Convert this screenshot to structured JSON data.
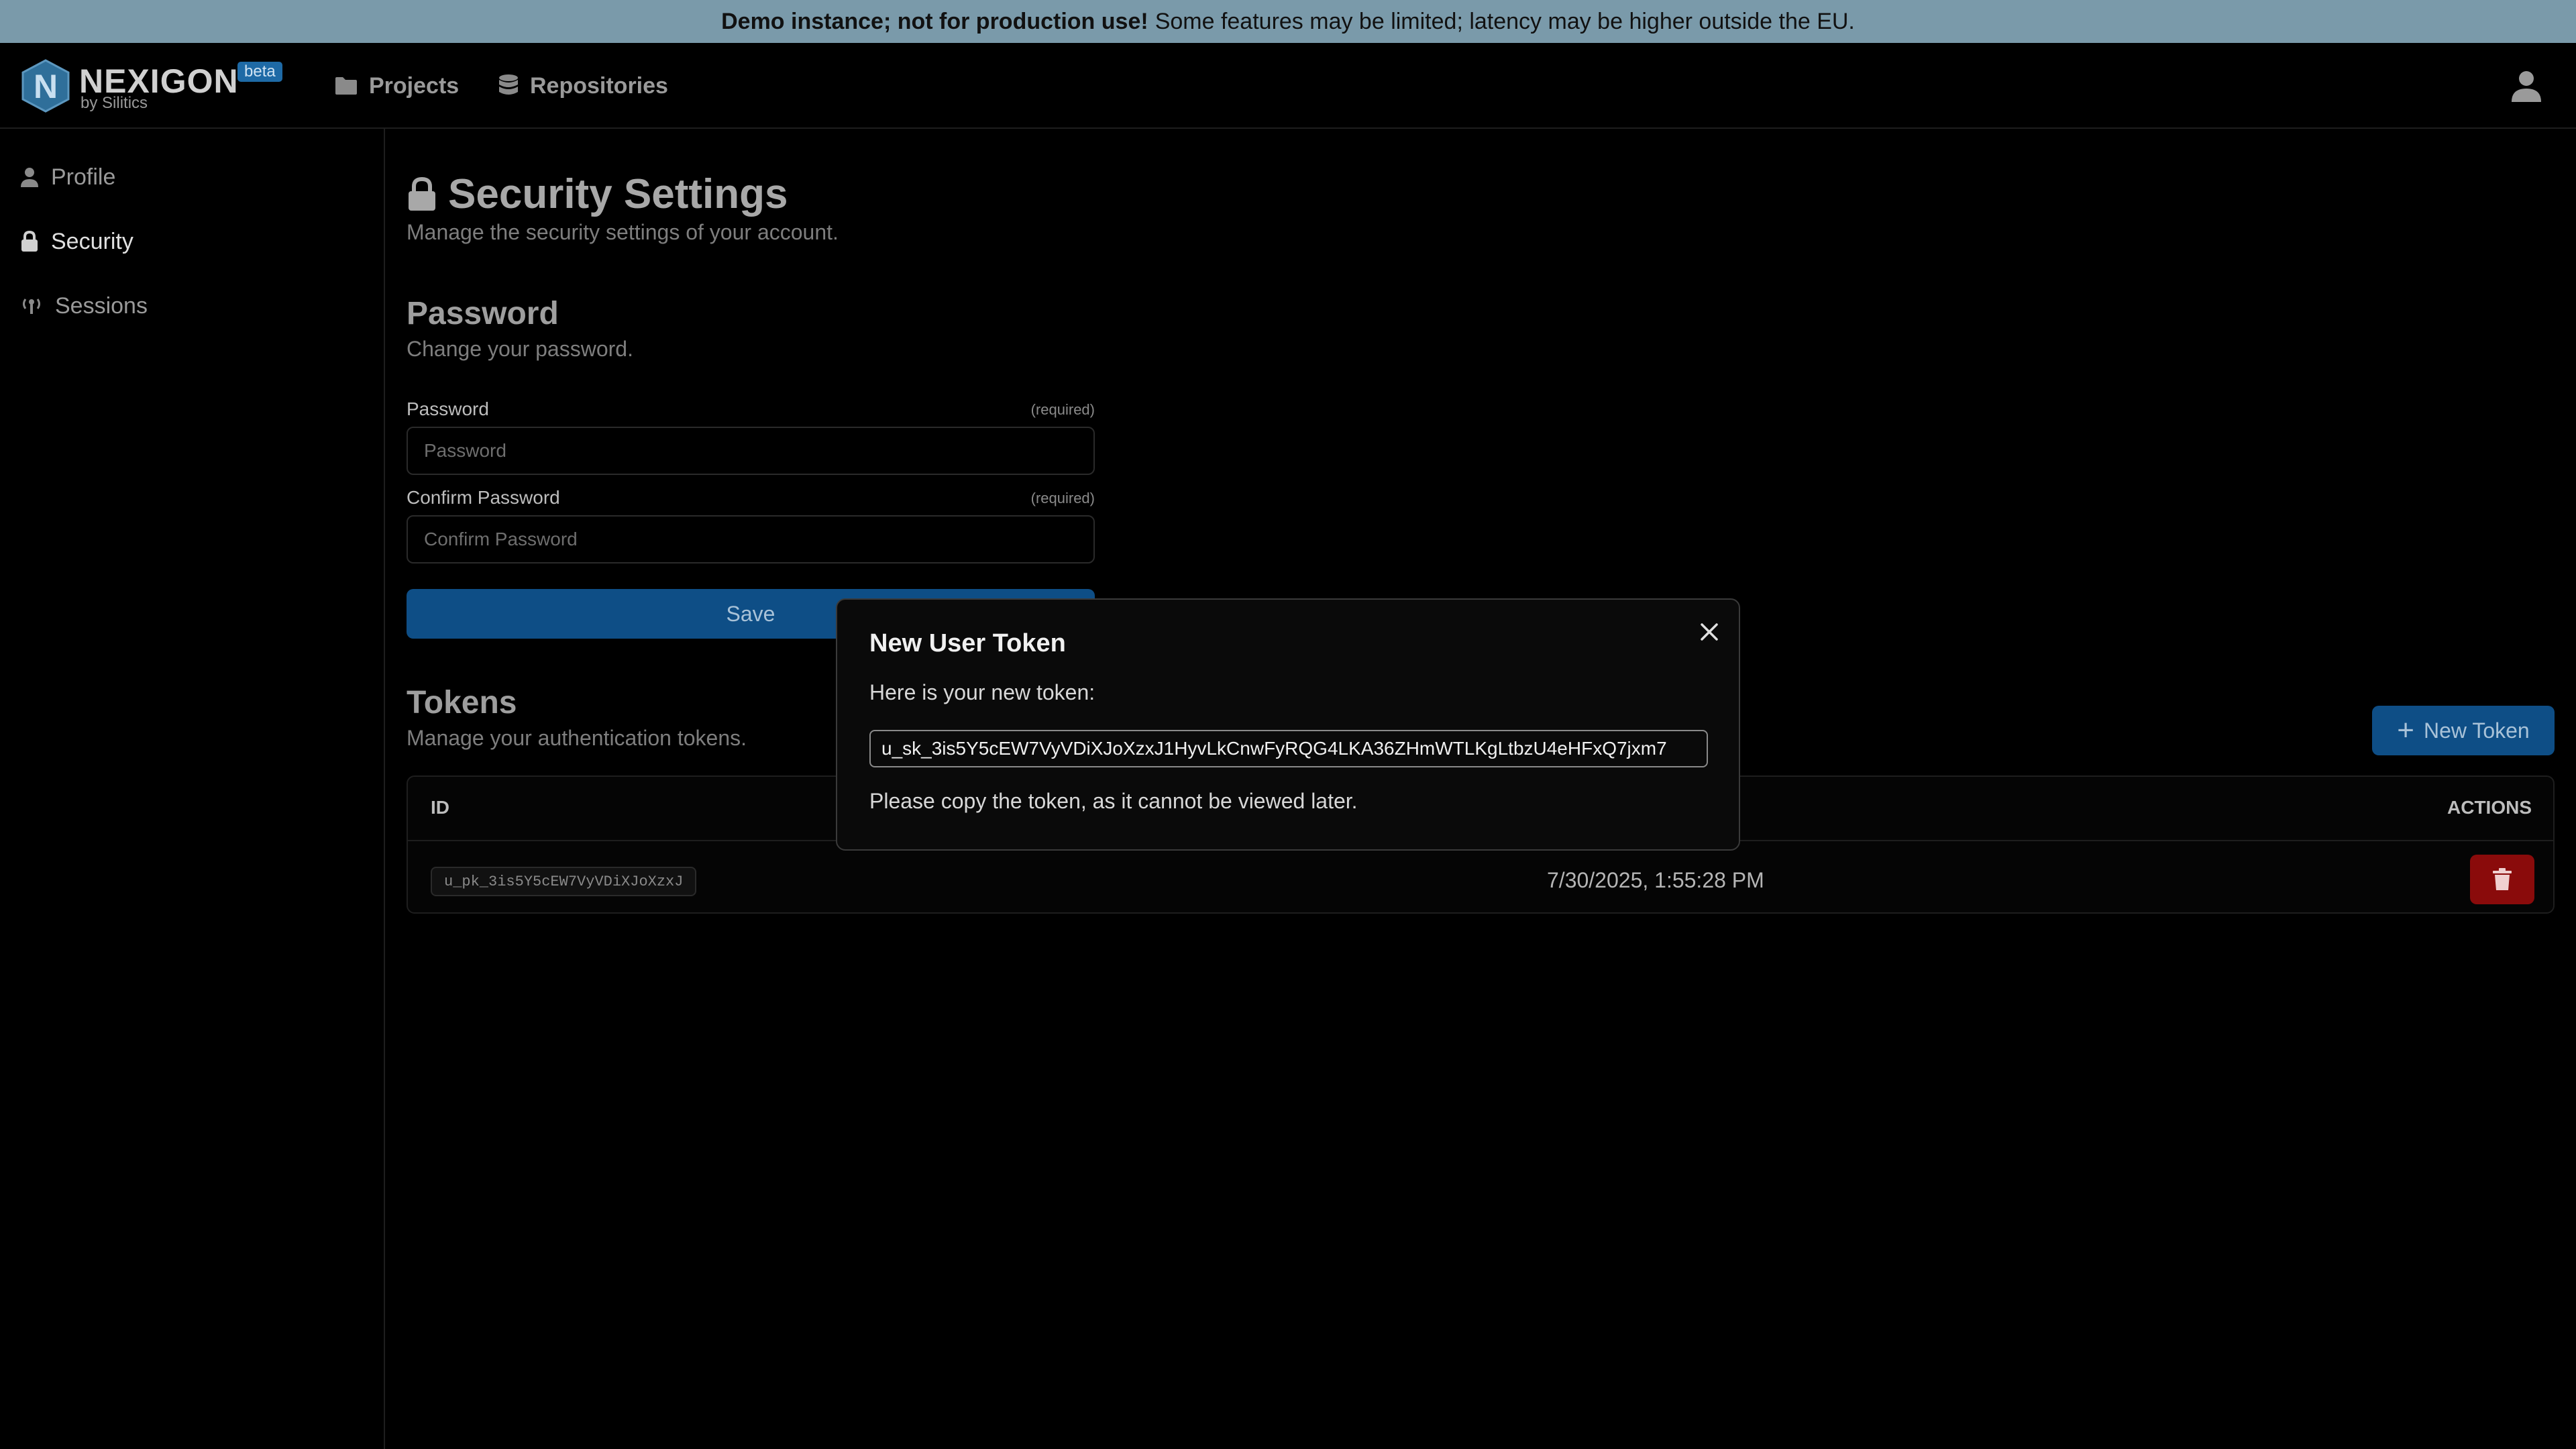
{
  "banner": {
    "bold": "Demo instance; not for production use!",
    "rest": "Some features may be limited; latency may be higher outside the EU."
  },
  "nav": {
    "brand": "NEXIGON",
    "badge": "beta",
    "byline": "by Silitics",
    "links": [
      {
        "label": "Projects",
        "icon": "folder-icon"
      },
      {
        "label": "Repositories",
        "icon": "database-icon"
      }
    ],
    "user_icon": "user-icon"
  },
  "sidebar": {
    "items": [
      {
        "label": "Profile",
        "icon": "user-icon",
        "active": false
      },
      {
        "label": "Security",
        "icon": "lock-icon",
        "active": true
      },
      {
        "label": "Sessions",
        "icon": "broadcast-icon",
        "active": false
      }
    ]
  },
  "page": {
    "title": "Security Settings",
    "subtitle": "Manage the security settings of your account."
  },
  "password": {
    "title": "Password",
    "subtitle": "Change your password.",
    "field1_label": "Password",
    "field1_placeholder": "Password",
    "field1_value": "",
    "field2_label": "Confirm Password",
    "field2_placeholder": "Confirm Password",
    "field2_value": "",
    "required": "(required)",
    "save_label": "Save"
  },
  "tokens": {
    "title": "Tokens",
    "subtitle": "Manage your authentication tokens.",
    "new_label": "New Token",
    "columns": [
      "ID",
      "ACTIONS"
    ],
    "rows": [
      {
        "id": "u_pk_3is5Y5cEW7VyVDiXJoXzxJ",
        "date": "7/30/2025, 1:55:28 PM"
      }
    ]
  },
  "modal": {
    "title": "New User Token",
    "intro": "Here is your new token:",
    "token": "u_sk_3is5Y5cEW7VyVDiXJoXzxJ1HyvLkCnwFyRQG4LKA36ZHmWTLKgLtbzU4eHFxQ7jxm7",
    "note": "Please copy the token, as it cannot be viewed later."
  },
  "colors": {
    "banner_bg": "#7a9aaa",
    "primary": "#0e4e86",
    "danger": "#8a0b0b",
    "background": "#000000"
  }
}
